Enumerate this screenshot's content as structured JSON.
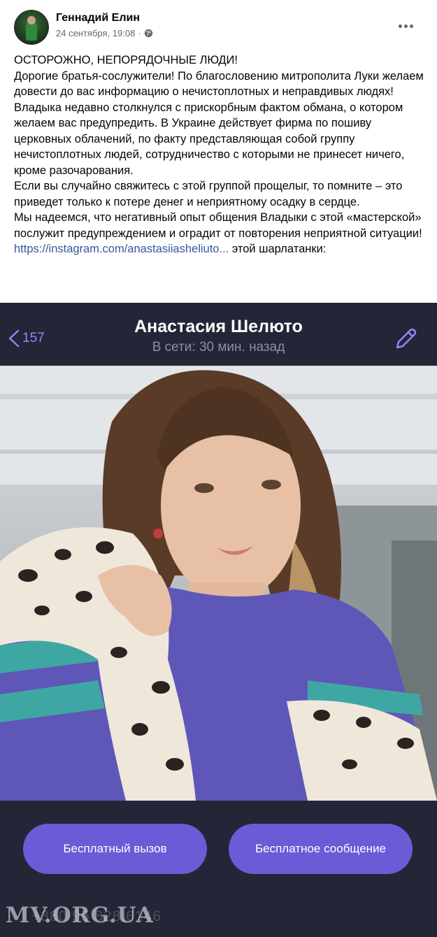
{
  "post": {
    "author": "Геннадий Елин",
    "date": "24 сентября, 19:08",
    "separator": "·",
    "privacy_icon": "globe-icon",
    "more_icon": "more-options-icon",
    "paragraphs": [
      "ОСТОРОЖНО, НЕПОРЯДОЧНЫЕ ЛЮДИ!",
      "Дорогие братья-сослужители! По благословению митрополита Луки желаем довести до вас информацию о нечистоплотных и неправдивых людях!",
      "Владыка недавно столкнулся с прискорбным фактом обмана, о котором желаем вас предупредить. В Украине действует фирма по пошиву церковных облачений, по факту представляющая собой группу нечистоплотных людей, сотрудничество с которыми не принесет ничего, кроме разочарования.",
      "Если вы случайно свяжитесь с этой группой прощелыг, то помните – это приведет только к потере денег и неприятному осадку в сердце.",
      "Мы надеемся, что негативный опыт общения Владыки с этой «мастерской» послужит предупреждением и оградит от повторения неприятной ситуации!"
    ],
    "link_text": "https://instagram.com/anastasiiasheliuto...",
    "link_suffix": " этой шарлатанки:"
  },
  "screenshot": {
    "back_count": "157",
    "profile_name": "Анастасия Шелюто",
    "status": "В сети: 30 мин. назад",
    "call_button": "Бесплатный вызов",
    "message_button": "Бесплатное сообщение",
    "phone": "+380 95 828 6146",
    "watermark": "MV.ORG.UA",
    "accent_color": "#6a5bd6",
    "icons": {
      "back": "chevron-left-icon",
      "edit": "pencil-icon"
    }
  }
}
